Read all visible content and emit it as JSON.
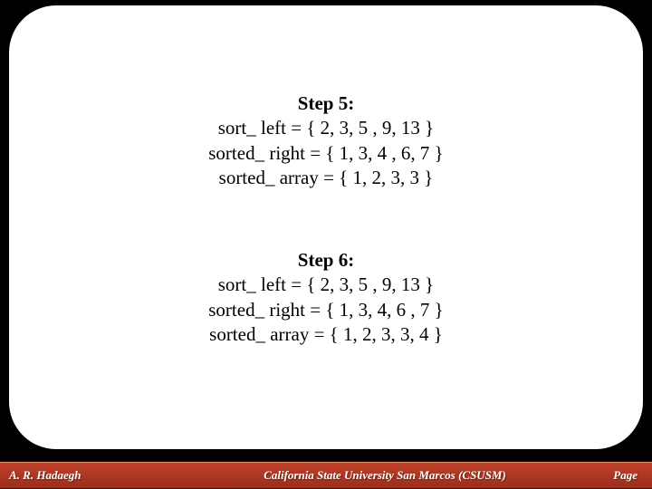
{
  "step5": {
    "title": "Step 5:",
    "line1": "sort_ left = { 2, 3, 5 , 9, 13 }",
    "line2": "sorted_ right = { 1, 3, 4 , 6, 7 }",
    "line3": "sorted_ array = { 1, 2, 3, 3 }"
  },
  "step6": {
    "title": "Step 6:",
    "line1": "sort_ left = { 2, 3, 5 , 9, 13 }",
    "line2": "sorted_ right = { 1, 3, 4, 6 , 7 }",
    "line3": "sorted_ array = { 1, 2, 3, 3, 4 }"
  },
  "footer": {
    "author": "A. R. Hadaegh",
    "institution": "California State University San Marcos (CSUSM)",
    "page_label": "Page"
  }
}
